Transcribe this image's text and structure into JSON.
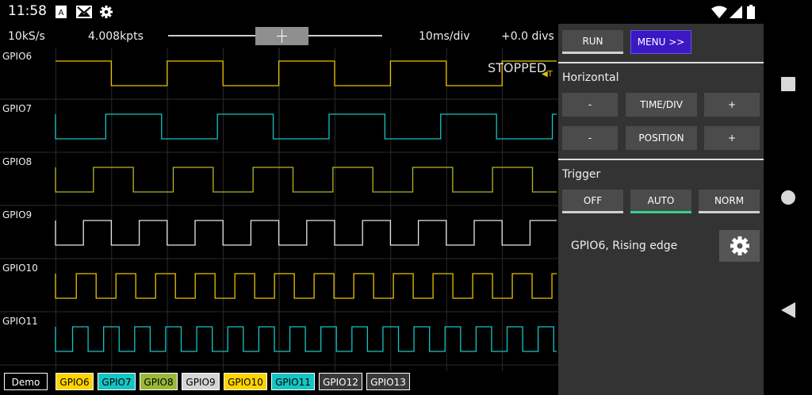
{
  "status_bar": {
    "time": "11:58",
    "left_icons": [
      "text-notification-icon",
      "gmail-icon",
      "settings-gear-icon"
    ],
    "right_icons": [
      "wifi-icon",
      "cell-signal-icon",
      "battery-icon"
    ]
  },
  "nav_bar": {
    "buttons": [
      "recents-icon",
      "home-icon",
      "back-icon"
    ]
  },
  "scope": {
    "sample_rate": "10kS/s",
    "points": "4.008kpts",
    "time_div": "10ms/div",
    "offset": "+0.0 divs",
    "horizontal_position_slider": 0.5,
    "state": "STOPPED",
    "trigger_marker": "◀T",
    "channels": [
      {
        "name": "GPIO6",
        "color": "#e8c200",
        "period_s": 0.02
      },
      {
        "name": "GPIO7",
        "color": "#16c4c4",
        "period_s": 0.02
      },
      {
        "name": "GPIO8",
        "color": "#b8b428",
        "period_s": 0.0143
      },
      {
        "name": "GPIO9",
        "color": "#e6e6e6",
        "period_s": 0.01
      },
      {
        "name": "GPIO10",
        "color": "#e8c200",
        "period_s": 0.0071
      },
      {
        "name": "GPIO11",
        "color": "#16c4c4",
        "period_s": 0.00556
      }
    ]
  },
  "legend": {
    "chips": [
      {
        "label": "Demo",
        "bg": "#000000",
        "fg": "#ffffff"
      },
      {
        "label": "GPIO6",
        "bg": "#ffd400",
        "fg": "#000000"
      },
      {
        "label": "GPIO7",
        "bg": "#16c4c4",
        "fg": "#000000"
      },
      {
        "label": "GPIO8",
        "bg": "#9bb83a",
        "fg": "#000000"
      },
      {
        "label": "GPIO9",
        "bg": "#d4d4d4",
        "fg": "#000000"
      },
      {
        "label": "GPIO10",
        "bg": "#ffd400",
        "fg": "#000000"
      },
      {
        "label": "GPIO11",
        "bg": "#16c4c4",
        "fg": "#000000"
      },
      {
        "label": "GPIO12",
        "bg": "#3a3a3a",
        "fg": "#ffffff"
      },
      {
        "label": "GPIO13",
        "bg": "#3a3a3a",
        "fg": "#ffffff"
      }
    ]
  },
  "panel": {
    "run_label": "RUN",
    "menu_label": "MENU >>",
    "horizontal_title": "Horizontal",
    "time_div_minus": "-",
    "time_div_label": "TIME/DIV",
    "time_div_plus": "+",
    "position_minus": "-",
    "position_label": "POSITION",
    "position_plus": "+",
    "trigger_title": "Trigger",
    "trigger_modes": [
      "OFF",
      "AUTO",
      "NORM"
    ],
    "trigger_selected": "AUTO",
    "trigger_description": "GPIO6, Rising edge"
  }
}
